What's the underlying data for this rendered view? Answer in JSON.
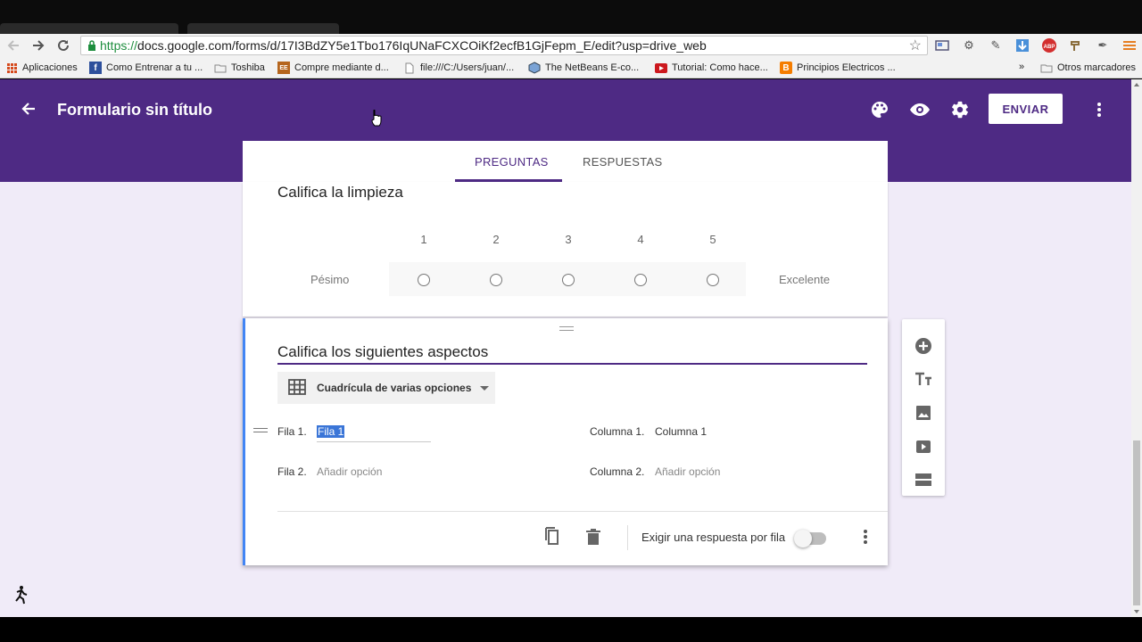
{
  "browser": {
    "url_scheme": "https://",
    "url_rest": "docs.google.com/forms/d/17I3BdZY5e1Tbo176IqUNaFCXCOiKf2ecfB1GjFepm_E/edit?usp=drive_web",
    "bookmarks": [
      {
        "label": "Aplicaciones",
        "icon": "apps-grid-icon"
      },
      {
        "label": "Como Entrenar a tu ...",
        "icon": "fb-icon"
      },
      {
        "label": "Toshiba",
        "icon": "folder-icon"
      },
      {
        "label": "Compre mediante d...",
        "icon": "ee-icon"
      },
      {
        "label": "file:///C:/Users/juan/...",
        "icon": "page-icon"
      },
      {
        "label": "The NetBeans E-co...",
        "icon": "netbeans-icon"
      },
      {
        "label": "Tutorial: Como hace...",
        "icon": "youtube-icon"
      },
      {
        "label": "Principios Electricos ...",
        "icon": "blogger-icon"
      }
    ],
    "bookmarks_overflow": "»",
    "other_bookmarks": "Otros marcadores"
  },
  "header": {
    "title": "Formulario sin título",
    "send_label": "ENVIAR"
  },
  "tabs": {
    "questions": "PREGUNTAS",
    "responses": "RESPUESTAS"
  },
  "question1": {
    "title": "Califica la limpieza",
    "scale": [
      "1",
      "2",
      "3",
      "4",
      "5"
    ],
    "min_label": "Pésimo",
    "max_label": "Excelente"
  },
  "question2": {
    "title": "Califica los siguientes aspectos",
    "type_label": "Cuadrícula de varias opciones",
    "row1_label": "Fila 1.",
    "row1_value": "Fila 1",
    "row2_label": "Fila 2.",
    "row2_placeholder": "Añadir opción",
    "col1_label": "Columna 1.",
    "col1_value": "Columna 1",
    "col2_label": "Columna 2.",
    "col2_placeholder": "Añadir opción",
    "required_label": "Exigir una respuesta por fila",
    "required_on": false
  },
  "colors": {
    "brand": "#4e2a84",
    "page_bg": "#f0ebf8",
    "active_border": "#4285f4"
  }
}
